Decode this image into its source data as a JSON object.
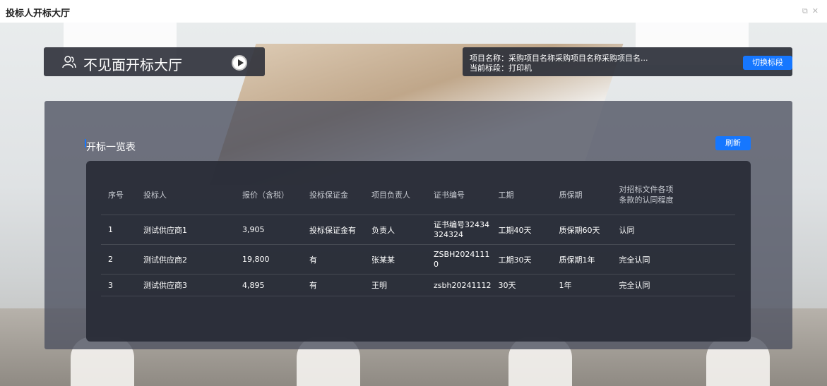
{
  "window": {
    "title": "投标人开标大厅",
    "icons": [
      "restore-icon",
      "close-icon"
    ]
  },
  "header": {
    "hall_title": "不见面开标大厅",
    "project_name": "项目名称：采购项目名称采购项目名称采购项目名...",
    "current_section": "当前标段：打印机",
    "switch_button": "切换标段"
  },
  "list": {
    "title": "开标一览表",
    "refresh_button": "刷新",
    "columns": [
      "序号",
      "投标人",
      "报价（含税）",
      "投标保证金",
      "项目负责人",
      "证书编号",
      "工期",
      "质保期",
      "对招标文件各项条款的认同程度"
    ],
    "rows": [
      {
        "no": "1",
        "bidder": "测试供应商1",
        "price": "3,905",
        "deposit": "投标保证金有",
        "manager": "负责人",
        "cert": "证书编号32434324324",
        "period": "工期40天",
        "warranty": "质保期60天",
        "agree": "认同"
      },
      {
        "no": "2",
        "bidder": "测试供应商2",
        "price": "19,800",
        "deposit": "有",
        "manager": "张某某",
        "cert": "ZSBH20241110",
        "period": "工期30天",
        "warranty": "质保期1年",
        "agree": "完全认同"
      },
      {
        "no": "3",
        "bidder": "测试供应商3",
        "price": "4,895",
        "deposit": "有",
        "manager": "王明",
        "cert": "zsbh20241112",
        "period": "30天",
        "warranty": "1年",
        "agree": "完全认同"
      }
    ]
  },
  "colors": {
    "accent": "#1677ff",
    "panel": "#2d303a"
  }
}
